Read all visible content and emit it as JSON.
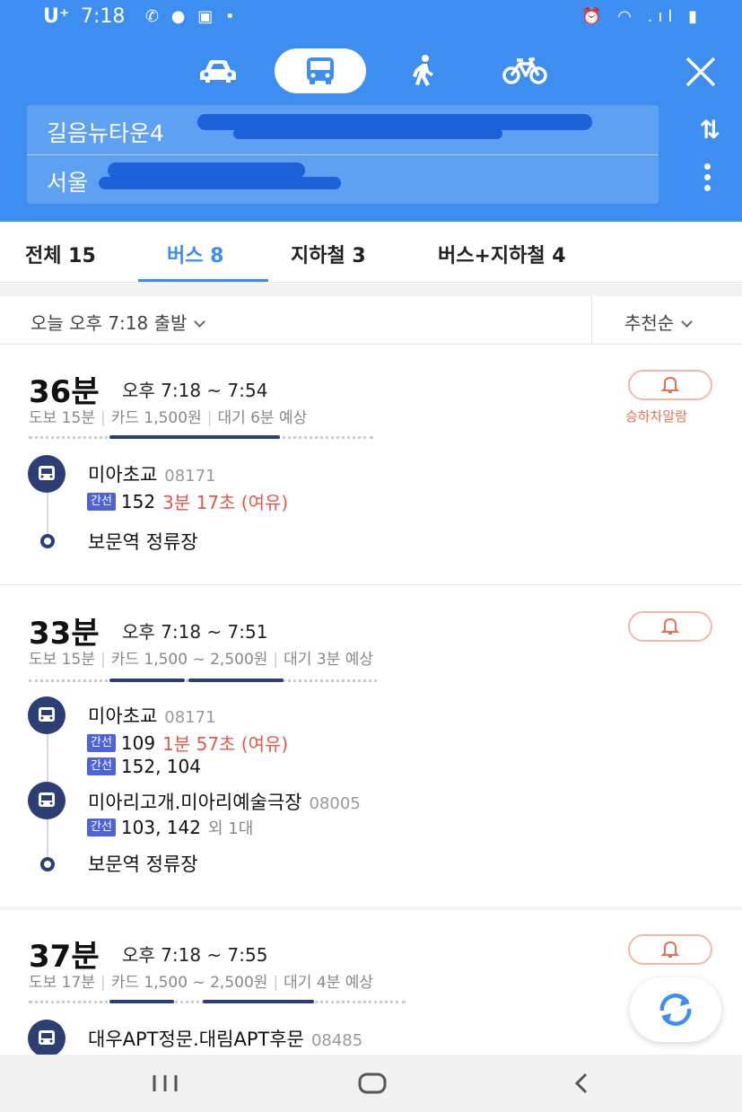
{
  "status_bar": {
    "carrier": "U⁺",
    "time": "7:18",
    "left_icons": "✆ ● ▣ •",
    "right_icons": "⏰ ◠ .ıl ▮"
  },
  "modes": [
    "car",
    "bus",
    "walk",
    "bike"
  ],
  "active_mode": "bus",
  "search": {
    "from": "길음뉴타운4",
    "to": "서울"
  },
  "tabs": [
    {
      "label": "전체 15"
    },
    {
      "label": "버스 8"
    },
    {
      "label": "지하철 3"
    },
    {
      "label": "버스+지하철 4"
    }
  ],
  "filter": {
    "depart": "오늘 오후 7:18 출발",
    "sort": "추천순"
  },
  "routes": [
    {
      "duration": "36분",
      "time_range": "오후 7:18 ~ 7:54",
      "walk": "도보 15분",
      "fare": "카드 1,500원",
      "wait": "대기 6분 예상",
      "alarm_label": "승하차알람",
      "first_stop": {
        "name": "미아초교",
        "code": "08171"
      },
      "bus_lines": [
        {
          "badge": "간선",
          "numbers": "152",
          "wait": "3분 17초 (여유)"
        }
      ],
      "end_stop": "보문역 정류장"
    },
    {
      "duration": "33분",
      "time_range": "오후 7:18 ~ 7:51",
      "walk": "도보 15분",
      "fare": "카드 1,500 ~ 2,500원",
      "wait": "대기 3분 예상",
      "first_stop": {
        "name": "미아초교",
        "code": "08171"
      },
      "bus_lines": [
        {
          "badge": "간선",
          "numbers": "109",
          "wait": "1분 57초 (여유)"
        },
        {
          "badge": "간선",
          "numbers": "152, 104"
        }
      ],
      "transfer_stop": {
        "name": "미아리고개.미아리예술극장",
        "code": "08005"
      },
      "transfer_lines": [
        {
          "badge": "간선",
          "numbers": "103, 142",
          "extra": "외 1대"
        }
      ],
      "end_stop": "보문역 정류장"
    },
    {
      "duration": "37분",
      "time_range": "오후 7:18 ~ 7:55",
      "walk": "도보 17분",
      "fare": "카드 1,500 ~ 2,500원",
      "wait": "대기 4분 예상",
      "first_stop": {
        "name": "대우APT정문.대림APT후문",
        "code": "08485"
      }
    }
  ],
  "colors": {
    "header_blue": "#3d8ef0",
    "route_navy": "#2c3e73",
    "badge_blue": "#4f63d8",
    "wait_red": "#e05a4a",
    "alarm_orange": "#e0745a"
  }
}
